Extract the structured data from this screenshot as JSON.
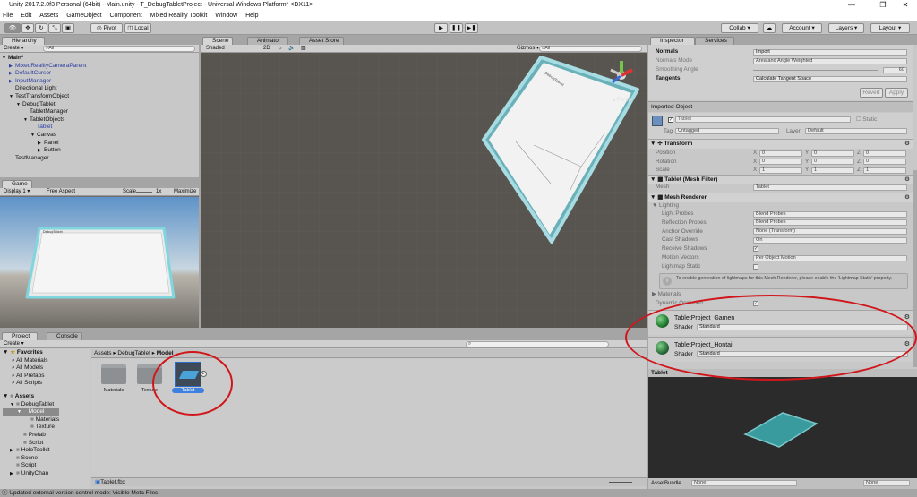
{
  "window": {
    "title": "Unity 2017.2.0f3 Personal (64bit) - Main.unity - T_DebugTabletProject - Universal Windows Platform* <DX11>",
    "min": "—",
    "max": "❐",
    "close": "✕"
  },
  "menu": [
    "File",
    "Edit",
    "Assets",
    "GameObject",
    "Component",
    "Mixed Reality Toolkit",
    "Window",
    "Help"
  ],
  "toolbar": {
    "pivot": "Pivot",
    "local": "Local",
    "collab": "Collab ▾",
    "account": "Account ▾",
    "layers": "Layers ▾",
    "layout": "Layout ▾"
  },
  "hierarchy": {
    "tab": "Hierarchy",
    "create": "Create ▾",
    "search": "All",
    "items": [
      {
        "label": "Main*",
        "indent": 0,
        "blue": false,
        "bold": true,
        "arrow": "▼"
      },
      {
        "label": "MixedRealityCameraParent",
        "indent": 1,
        "blue": true,
        "arrow": "▶"
      },
      {
        "label": "DefaultCursor",
        "indent": 1,
        "blue": true,
        "arrow": "▶"
      },
      {
        "label": "InputManager",
        "indent": 1,
        "blue": true,
        "arrow": "▶"
      },
      {
        "label": "Directional Light",
        "indent": 1,
        "blue": false,
        "arrow": ""
      },
      {
        "label": "TestTransformObject",
        "indent": 1,
        "blue": false,
        "arrow": "▼"
      },
      {
        "label": "DebugTablet",
        "indent": 2,
        "blue": false,
        "arrow": "▼"
      },
      {
        "label": "TabletManager",
        "indent": 3,
        "blue": false,
        "arrow": ""
      },
      {
        "label": "TabletObjects",
        "indent": 3,
        "blue": false,
        "arrow": "▼"
      },
      {
        "label": "Tablet",
        "indent": 4,
        "blue": true,
        "arrow": ""
      },
      {
        "label": "Canvas",
        "indent": 4,
        "blue": false,
        "arrow": "▼"
      },
      {
        "label": "Panel",
        "indent": 5,
        "blue": false,
        "arrow": "▶"
      },
      {
        "label": "Button",
        "indent": 5,
        "blue": false,
        "arrow": "▶"
      },
      {
        "label": "TestManager",
        "indent": 1,
        "blue": false,
        "arrow": ""
      }
    ]
  },
  "game": {
    "tab": "Game",
    "display": "Display 1 ▾",
    "aspect": "Free Aspect",
    "scale": "Scale",
    "scale_val": "1x",
    "maximize": "Maximize",
    "canvas_label": "DebugTablet"
  },
  "scene": {
    "tabs": [
      "Scene",
      "Animator",
      "Asset Store"
    ],
    "shading": "Shaded",
    "mode2d": "2D",
    "gizmos": "Gizmos ▾",
    "search": "All",
    "persp": "◂ Persp",
    "canvas_label": "DebugTablet"
  },
  "project": {
    "tabs": [
      "Project",
      "Console"
    ],
    "create": "Create ▾",
    "favorites_label": "Favorites",
    "favorites": [
      "All Materials",
      "All Models",
      "All Prefabs",
      "All Scripts"
    ],
    "assets_label": "Assets",
    "tree": [
      {
        "label": "DebugTablet",
        "indent": 1,
        "arrow": "▼"
      },
      {
        "label": "Model",
        "indent": 2,
        "arrow": "▼",
        "sel": true
      },
      {
        "label": "Materials",
        "indent": 3,
        "arrow": ""
      },
      {
        "label": "Texture",
        "indent": 3,
        "arrow": ""
      },
      {
        "label": "Prefab",
        "indent": 2,
        "arrow": ""
      },
      {
        "label": "Script",
        "indent": 2,
        "arrow": ""
      },
      {
        "label": "HoloToolkit",
        "indent": 1,
        "arrow": "▶"
      },
      {
        "label": "Scene",
        "indent": 1,
        "arrow": ""
      },
      {
        "label": "Script",
        "indent": 1,
        "arrow": ""
      },
      {
        "label": "UnityChan",
        "indent": 1,
        "arrow": "▶"
      }
    ],
    "breadcrumb": [
      "Assets",
      "DebugTablet",
      "Model"
    ],
    "tiles": [
      "Materials",
      "Texture",
      "Tablet"
    ],
    "footer_file": "Tablet.fbx"
  },
  "inspector": {
    "tabs": [
      "Inspector",
      "Services"
    ],
    "import": [
      {
        "label": "Normals",
        "value": "Import",
        "bold": true
      },
      {
        "label": "Normals Mode",
        "value": "Area and Angle Weighted",
        "dis": true
      },
      {
        "label": "Smoothing Angle",
        "value": "60",
        "dis": true
      },
      {
        "label": "Tangents",
        "value": "Calculate Tangent Space",
        "bold": true
      }
    ],
    "revert": "Revert",
    "apply": "Apply",
    "imported_object": "Imported Object",
    "object_name": "Tablet",
    "static": "Static",
    "tag_label": "Tag",
    "tag": "Untagged",
    "layer_label": "Layer",
    "layer": "Default",
    "transform": {
      "title": "Transform",
      "rows": [
        {
          "label": "Position",
          "x": "0",
          "y": "0",
          "z": "0"
        },
        {
          "label": "Rotation",
          "x": "0",
          "y": "0",
          "z": "0"
        },
        {
          "label": "Scale",
          "x": "1",
          "y": "1",
          "z": "1"
        }
      ]
    },
    "mesh_filter": {
      "title": "Tablet (Mesh Filter)",
      "mesh_label": "Mesh",
      "mesh": "Tablet"
    },
    "mesh_renderer": {
      "title": "Mesh Renderer",
      "lighting": "Lighting",
      "rows": [
        {
          "label": "Light Probes",
          "value": "Blend Probes"
        },
        {
          "label": "Reflection Probes",
          "value": "Blend Probes"
        },
        {
          "label": "Anchor Override",
          "value": "None (Transform)"
        },
        {
          "label": "Cast Shadows",
          "value": "On"
        },
        {
          "label": "Receive Shadows",
          "value": "✓"
        },
        {
          "label": "Motion Vectors",
          "value": "Per Object Motion"
        },
        {
          "label": "Lightmap Static",
          "value": ""
        }
      ],
      "info": "To enable generation of lightmaps for this Mesh Renderer, please enable the 'Lightmap Static' property.",
      "materials": "Materials",
      "dynamic": "Dynamic Occluded"
    },
    "materials": [
      {
        "name": "TabletProject_Gamen",
        "shader_label": "Shader",
        "shader": "Standard",
        "color": "#1f7a2e"
      },
      {
        "name": "TabletProject_Hontai",
        "shader_label": "Shader",
        "shader": "Standard",
        "color": "#2a6e3a"
      }
    ],
    "preview_title": "Tablet",
    "assetbundle_label": "AssetBundle",
    "assetbundle": "None",
    "variant": "None"
  },
  "status": "Updated external version control mode: Visible Meta Files"
}
